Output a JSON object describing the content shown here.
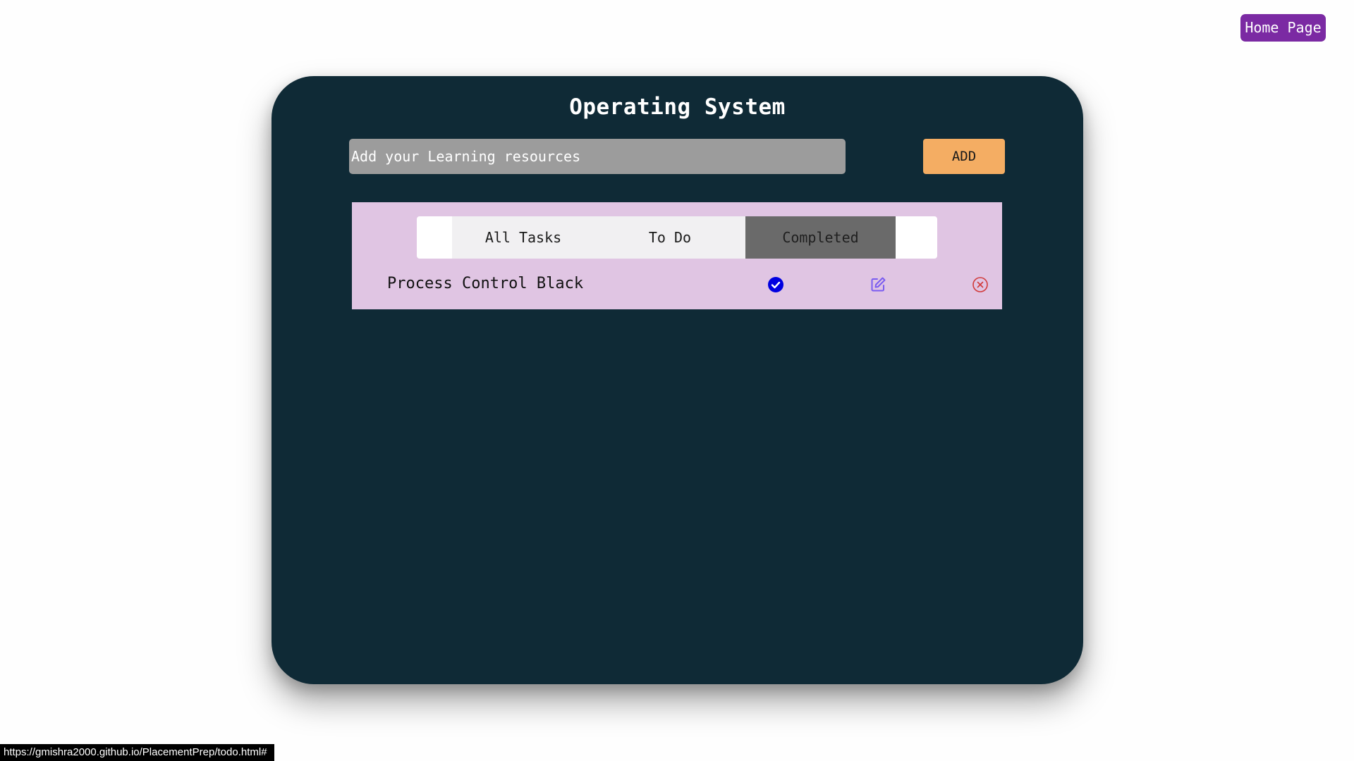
{
  "header": {
    "home_button_label": "Home Page"
  },
  "card": {
    "title": "Operating System",
    "input": {
      "placeholder": "Add your Learning resources",
      "value": ""
    },
    "add_button_label": "ADD",
    "tabs": [
      {
        "label": "All Tasks",
        "active": false
      },
      {
        "label": "To Do",
        "active": false
      },
      {
        "label": "Completed",
        "active": true
      }
    ],
    "tasks": [
      {
        "text": "Process Control Black",
        "completed": true
      }
    ]
  },
  "status_bar": {
    "url": "https://gmishra2000.github.io/PlacementPrep/todo.html#"
  },
  "colors": {
    "page_background": "#fefefe",
    "card_background": "#0f2a36",
    "home_button": "#7b2aa3",
    "add_button": "#f4ad63",
    "input_background": "#9c9c9c",
    "task_panel": "#e0c5e3",
    "active_tab": "#6a6a6a",
    "check_icon": "#0000e0",
    "edit_icon": "#7a5cf0",
    "delete_icon": "#d13a3a"
  },
  "icons": {
    "check": "check-circle-icon",
    "edit": "edit-icon",
    "delete": "close-circle-icon"
  }
}
